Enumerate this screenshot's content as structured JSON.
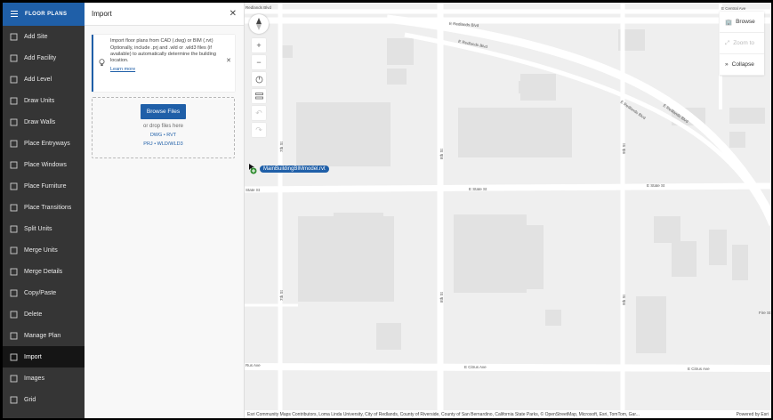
{
  "sidebar": {
    "title": "FLOOR PLANS",
    "items": [
      {
        "label": "Add Site",
        "icon": "add-site-icon"
      },
      {
        "label": "Add Facility",
        "icon": "add-facility-icon"
      },
      {
        "label": "Add Level",
        "icon": "add-level-icon"
      },
      {
        "label": "Draw Units",
        "icon": "draw-units-icon"
      },
      {
        "label": "Draw Walls",
        "icon": "draw-walls-icon"
      },
      {
        "label": "Place Entryways",
        "icon": "entryway-icon"
      },
      {
        "label": "Place Windows",
        "icon": "window-icon"
      },
      {
        "label": "Place Furniture",
        "icon": "furniture-icon"
      },
      {
        "label": "Place Transitions",
        "icon": "transition-icon"
      },
      {
        "label": "Split Units",
        "icon": "split-icon"
      },
      {
        "label": "Merge Units",
        "icon": "merge-icon"
      },
      {
        "label": "Merge Details",
        "icon": "merge-details-icon"
      },
      {
        "label": "Copy/Paste",
        "icon": "copy-icon"
      },
      {
        "label": "Delete",
        "icon": "trash-icon"
      },
      {
        "label": "Manage Plan",
        "icon": "manage-plan-icon"
      },
      {
        "label": "Import",
        "icon": "import-icon",
        "active": true
      },
      {
        "label": "Images",
        "icon": "images-icon"
      },
      {
        "label": "Grid",
        "icon": "grid-icon"
      }
    ]
  },
  "panel": {
    "title": "Import",
    "notice": {
      "line1": "Import floor plans from CAD (.dwg) or BIM (.rvt)",
      "line2": "Optionally, include .prj and .wld or .wld3 files (if available) to automatically determine the building location.",
      "link": "Learn more"
    },
    "browse_label": "Browse Files",
    "drop_text": "or drop files here",
    "formats_primary": "DWG • RVT",
    "formats_secondary": "PRJ • WLD/WLD3"
  },
  "map": {
    "marker_label": "MainBuildingBIMmodel.rvt",
    "right_tools": {
      "browse": "Browse",
      "zoom_to": "Zoom to",
      "collapse": "Collapse"
    },
    "streets": {
      "redlands_top": "E Redlands Blvd",
      "redlands_upper": "E Redlands Blvd",
      "redlands_diag": "E Redlands Blvd",
      "redlands_diag2": "E Redlands Blvd",
      "central": "E Central Ave",
      "state": "E State St",
      "state_right": "E State St",
      "state_left": "State St",
      "citrus": "E Citrus Ave",
      "citrus_right": "E Citrus Ave",
      "citrus_left": "Rus Ave",
      "st7_top": "7th St",
      "st7_bot": "7th St",
      "st8_top": "8th St",
      "st8_bot": "8th St",
      "st9_top": "9th St",
      "st9_bot": "9th St",
      "redlands_left": "Redlands Blvd",
      "fire": "Fire St"
    },
    "attribution": "Esri Community Maps Contributors, Loma Linda University, City of Redlands, County of Riverside, County of San Bernardino, California State Parks, © OpenStreetMap, Microsoft, Esri, TomTom, Gar...",
    "powered_by": "Powered by Esri"
  }
}
